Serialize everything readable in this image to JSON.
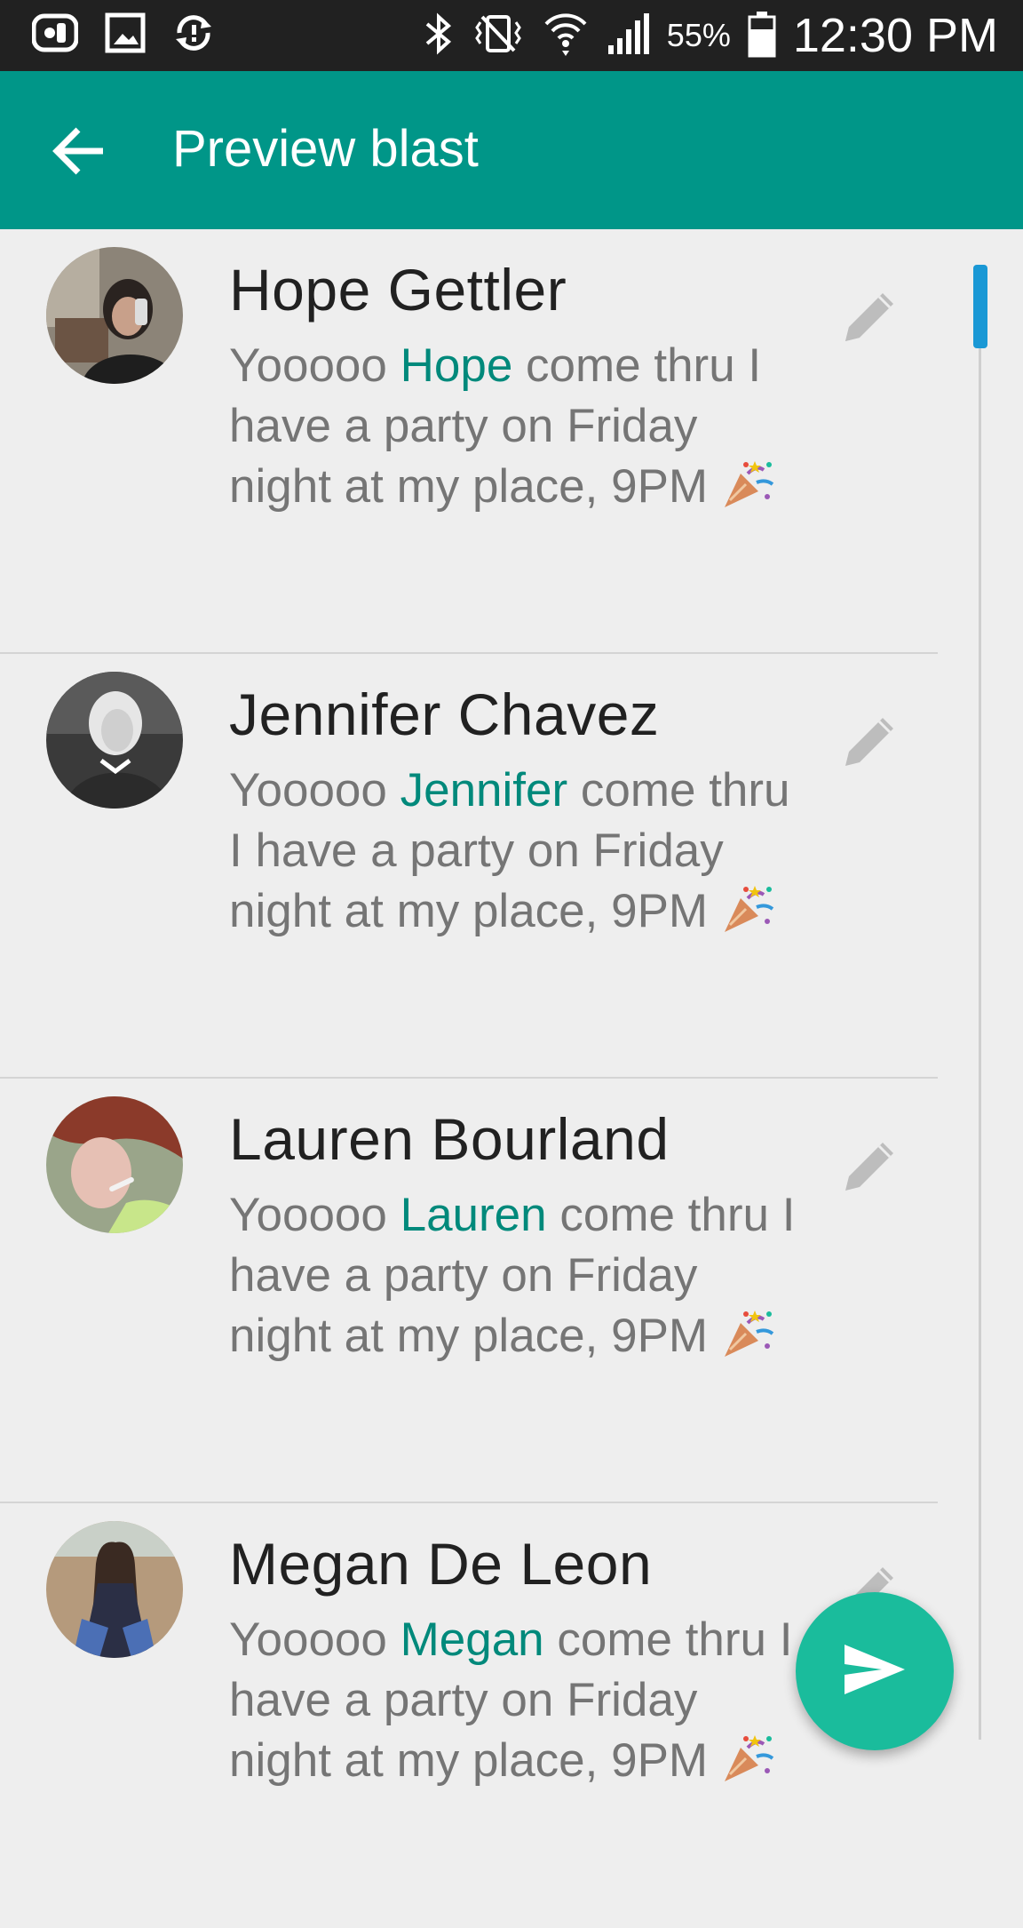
{
  "status_bar": {
    "battery_percent": "55%",
    "time": "12:30 PM",
    "icons": [
      "voicemail-icon",
      "image-icon",
      "sync-icon",
      "bluetooth-icon",
      "vibrate-icon",
      "wifi-icon",
      "signal-icon",
      "battery-icon"
    ]
  },
  "app_bar": {
    "title": "Preview blast",
    "back_icon": "arrow-back-icon"
  },
  "contacts": [
    {
      "name": "Hope Gettler",
      "msg_before": "Yooooo ",
      "msg_name": "Hope",
      "msg_after": " come thru I have a party on Friday night at my place, 9PM ",
      "avatar_color": "#6d5a4a"
    },
    {
      "name": "Jennifer Chavez",
      "msg_before": "Yooooo ",
      "msg_name": "Jennifer",
      "msg_after": " come thru I have a party on Friday night at my place, 9PM ",
      "avatar_color": "#4a4a4a"
    },
    {
      "name": "Lauren Bourland",
      "msg_before": "Yooooo ",
      "msg_name": "Lauren",
      "msg_after": " come thru I have a party on Friday night at my place, 9PM ",
      "avatar_color": "#a86055"
    },
    {
      "name": "Megan De Leon",
      "msg_before": "Yooooo ",
      "msg_name": "Megan",
      "msg_after": " come thru I have a party on Friday night at my place, 9PM ",
      "avatar_color": "#8a7260"
    }
  ],
  "colors": {
    "app_bar": "#009688",
    "highlight": "#00897b",
    "fab": "#1abc9c",
    "scroll_thumb": "#1a98d5"
  },
  "fab_icon": "send-icon",
  "edit_icon": "pencil-icon"
}
